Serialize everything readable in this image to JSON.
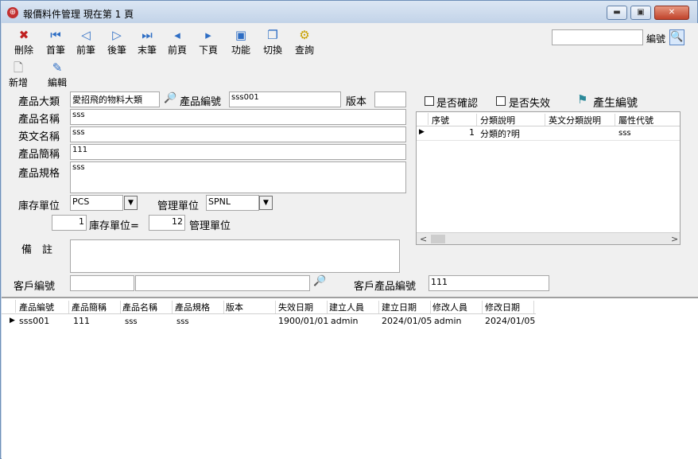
{
  "window": {
    "title": "報價料件管理 現在第 1 頁",
    "minimize": "▬",
    "maximize": "▣",
    "close": "✕"
  },
  "toolbar": {
    "delete": "刪除",
    "first": "首筆",
    "prev": "前筆",
    "next": "後筆",
    "last": "末筆",
    "prev_page": "前頁",
    "next_page": "下頁",
    "functions": "功能",
    "switch": "切換",
    "query": "查詢",
    "add": "新增",
    "edit": "編輯",
    "search_value": "",
    "search_label": "編號"
  },
  "form": {
    "category_label": "產品大類",
    "category_value": "愛招飛的物料大類",
    "code_label": "產品編號",
    "code_value": "sss001",
    "version_label": "版本",
    "version_value": "",
    "name_label": "產品名稱",
    "name_value": "sss",
    "english_label": "英文名稱",
    "english_value": "sss",
    "short_label": "產品簡稱",
    "short_value": "111",
    "spec_label": "產品規格",
    "spec_value": "sss",
    "stock_unit_label": "庫存單位",
    "stock_unit_value": "PCS",
    "mgmt_unit_label": "管理單位",
    "mgmt_unit_value": "SPNL",
    "ratio_left": "1",
    "ratio_mid_label": "庫存單位=",
    "ratio_right": "12",
    "ratio_right_label": "管理單位",
    "remark_label": "備　註",
    "remark_value": "",
    "customer_label": "客戶編號",
    "customer_code": "",
    "customer_name": "",
    "cust_product_label": "客戶產品編號",
    "cust_product_value": "111",
    "confirmed_label": "是否確認",
    "invalid_label": "是否失效",
    "gen_code_label": "產生編號"
  },
  "attr_grid": {
    "headers": [
      "序號",
      "分類說明",
      "英文分類說明",
      "屬性代號"
    ],
    "rows": [
      {
        "seq": "1",
        "desc": "分類的?明",
        "en_desc": "",
        "code": "sss"
      }
    ]
  },
  "list_grid": {
    "headers": [
      "產品編號",
      "產品簡稱",
      "產品名稱",
      "產品規格",
      "版本",
      "失效日期",
      "建立人員",
      "建立日期",
      "修改人員",
      "修改日期"
    ],
    "rows": [
      {
        "code": "sss001",
        "short": "111",
        "name": "sss",
        "spec": "sss",
        "version": "",
        "expire": "1900/01/01",
        "creator": "admin",
        "created": "2024/01/05",
        "modifier": "admin",
        "modified": "2024/01/05"
      }
    ]
  }
}
